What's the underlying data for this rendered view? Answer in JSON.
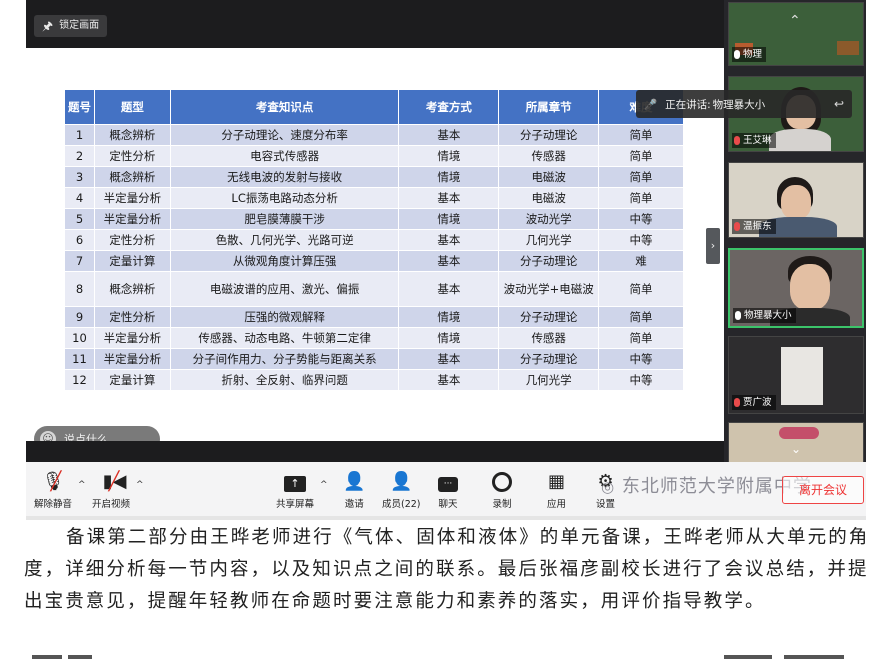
{
  "meeting": {
    "lock_label": "锁定画面",
    "chat_placeholder": "说点什么...",
    "speaking": {
      "prefix": "正在讲话:",
      "name": "物理暴大小"
    },
    "table": {
      "headers": [
        "题号",
        "题型",
        "考查知识点",
        "考查方式",
        "所属章节",
        "难度"
      ],
      "rows": [
        [
          "1",
          "概念辨析",
          "分子动理论、速度分布率",
          "基本",
          "分子动理论",
          "简单"
        ],
        [
          "2",
          "定性分析",
          "电容式传感器",
          "情境",
          "传感器",
          "简单"
        ],
        [
          "3",
          "概念辨析",
          "无线电波的发射与接收",
          "情境",
          "电磁波",
          "简单"
        ],
        [
          "4",
          "半定量分析",
          "LC振荡电路动态分析",
          "基本",
          "电磁波",
          "简单"
        ],
        [
          "5",
          "半定量分析",
          "肥皂膜薄膜干涉",
          "情境",
          "波动光学",
          "中等"
        ],
        [
          "6",
          "定性分析",
          "色散、几何光学、光路可逆",
          "基本",
          "几何光学",
          "中等"
        ],
        [
          "7",
          "定量计算",
          "从微观角度计算压强",
          "基本",
          "分子动理论",
          "难"
        ],
        [
          "8",
          "概念辨析",
          "电磁波谱的应用、激光、偏振",
          "基本",
          "波动光学+电磁波",
          "简单"
        ],
        [
          "9",
          "定性分析",
          "压强的微观解释",
          "情境",
          "分子动理论",
          "简单"
        ],
        [
          "10",
          "半定量分析",
          "传感器、动态电路、牛顿第二定律",
          "情境",
          "传感器",
          "简单"
        ],
        [
          "11",
          "半定量分析",
          "分子间作用力、分子势能与距离关系",
          "基本",
          "分子动理论",
          "中等"
        ],
        [
          "12",
          "定量计算",
          "折射、全反射、临界问题",
          "基本",
          "几何光学",
          "中等"
        ]
      ]
    },
    "participants": [
      {
        "name": "物理",
        "mic": "on"
      },
      {
        "name": "王艾琳",
        "mic": "off"
      },
      {
        "name": "温振东",
        "mic": "off"
      },
      {
        "name": "物理暴大小",
        "mic": "on"
      },
      {
        "name": "贾广波",
        "mic": "off"
      }
    ],
    "toolbar": {
      "unmute": "解除静音",
      "video": "开启视频",
      "share": "共享屏幕",
      "invite": "邀请",
      "members": "成员(22)",
      "chat": "聊天",
      "record": "录制",
      "apps": "应用",
      "settings": "设置",
      "leave": "离开会议"
    },
    "watermark": "东北师范大学附属中学"
  },
  "article": {
    "text": "备课第二部分由王晔老师进行《气体、固体和液体》的单元备课，王晔老师从大单元的角度，详细分析每一节内容，以及知识点之间的联系。最后张福彦副校长进行了会议总结，并提出宝贵意见，提醒年轻教师在命题时要注意能力和素养的落实，用评价指导教学。"
  },
  "colors": {
    "table_header": "#4472c4",
    "row_odd": "#cfd5ea",
    "row_even": "#e9ebf5",
    "leave_red": "#e33333",
    "speaking_border": "#3cc46a"
  }
}
